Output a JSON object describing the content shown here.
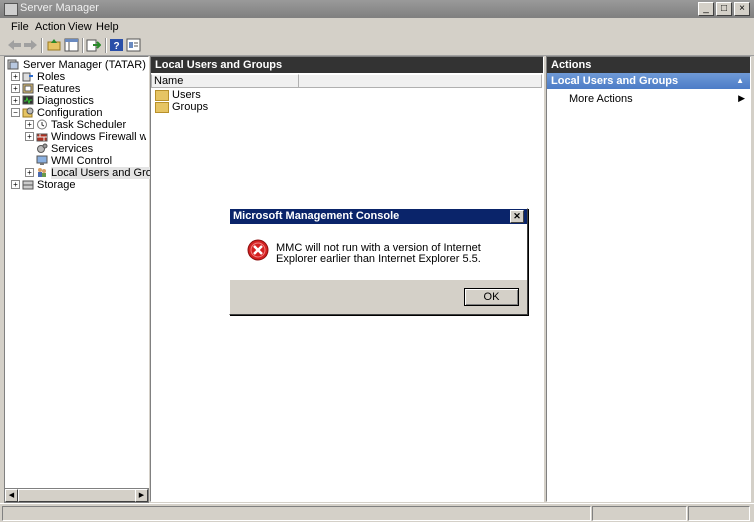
{
  "window": {
    "title": "Server Manager",
    "buttons": [
      "_",
      "□",
      "×"
    ]
  },
  "menu": [
    "File",
    "Action",
    "View",
    "Help"
  ],
  "toolbar_icons": [
    "back-icon",
    "forward-icon",
    "up-folder-icon",
    "show-hide-tree-icon",
    "export-icon",
    "help-icon",
    "properties-icon"
  ],
  "tree": {
    "root": "Server Manager (TATAR)",
    "items": [
      {
        "label": "Roles",
        "icon": "roles-icon",
        "expander": "+"
      },
      {
        "label": "Features",
        "icon": "features-icon",
        "expander": "+"
      },
      {
        "label": "Diagnostics",
        "icon": "diagnostics-icon",
        "expander": "+"
      },
      {
        "label": "Configuration",
        "icon": "configuration-icon",
        "expander": "−"
      },
      {
        "label": "Task Scheduler",
        "icon": "task-scheduler-icon",
        "expander": "+"
      },
      {
        "label": "Windows Firewall with Adva",
        "icon": "firewall-icon",
        "expander": "+"
      },
      {
        "label": "Services",
        "icon": "services-icon",
        "expander": ""
      },
      {
        "label": "WMI Control",
        "icon": "wmi-icon",
        "expander": ""
      },
      {
        "label": "Local Users and Groups",
        "icon": "users-groups-icon",
        "expander": "+"
      },
      {
        "label": "Storage",
        "icon": "storage-icon",
        "expander": "+"
      }
    ]
  },
  "middle": {
    "header": "Local Users and Groups",
    "column": "Name",
    "rows": [
      "Users",
      "Groups"
    ]
  },
  "actions": {
    "header": "Actions",
    "section": "Local Users and Groups",
    "items": [
      "More Actions"
    ]
  },
  "dialog": {
    "title": "Microsoft Management Console",
    "message": "MMC will not run with a version of Internet Explorer earlier than Internet Explorer 5.5.",
    "ok": "OK"
  }
}
